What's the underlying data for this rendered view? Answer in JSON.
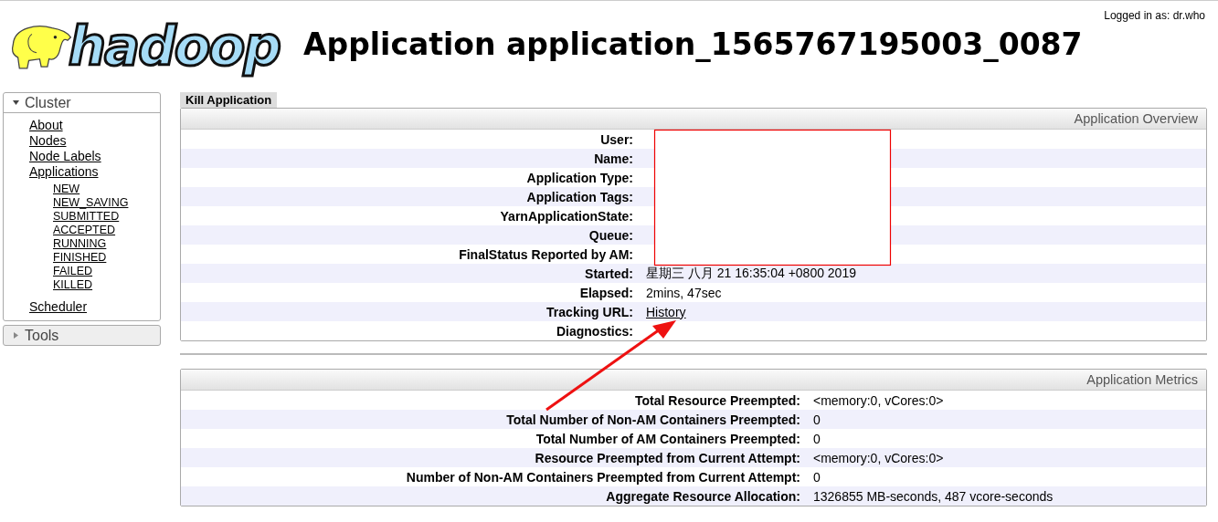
{
  "header": {
    "logo_text": "hadoop",
    "title": "Application application_1565767195003_0087",
    "login": "Logged in as: dr.who"
  },
  "sidebar": {
    "sections": [
      {
        "title": "Cluster",
        "expanded": true,
        "items": [
          {
            "label": "About"
          },
          {
            "label": "Nodes"
          },
          {
            "label": "Node Labels"
          },
          {
            "label": "Applications",
            "children": [
              {
                "label": "NEW"
              },
              {
                "label": "NEW_SAVING"
              },
              {
                "label": "SUBMITTED"
              },
              {
                "label": "ACCEPTED"
              },
              {
                "label": "RUNNING"
              },
              {
                "label": "FINISHED"
              },
              {
                "label": "FAILED"
              },
              {
                "label": "KILLED"
              }
            ]
          },
          {
            "label": "Scheduler"
          }
        ]
      },
      {
        "title": "Tools",
        "expanded": false
      }
    ]
  },
  "actions": [
    "Kill Application"
  ],
  "overview": {
    "title": "Application Overview",
    "rows": [
      {
        "label": "User:"
      },
      {
        "label": "Name:"
      },
      {
        "label": "Application Type:"
      },
      {
        "label": "Application Tags:"
      },
      {
        "label": "YarnApplicationState:"
      },
      {
        "label": "Queue:"
      },
      {
        "label": "FinalStatus Reported by AM:"
      },
      {
        "label": "Started:",
        "value": "星期三 八月 21 16:35:04 +0800 2019",
        "kind": "text"
      },
      {
        "label": "Elapsed:",
        "value": "2mins, 47sec",
        "kind": "text"
      },
      {
        "label": "Tracking URL:",
        "value": "History",
        "kind": "link"
      },
      {
        "label": "Diagnostics:"
      }
    ]
  },
  "metrics": {
    "title": "Application Metrics",
    "rows": [
      {
        "label": "Total Resource Preempted:",
        "value": "<memory:0, vCores:0>"
      },
      {
        "label": "Total Number of Non-AM Containers Preempted:",
        "value": "0"
      },
      {
        "label": "Total Number of AM Containers Preempted:",
        "value": "0"
      },
      {
        "label": "Resource Preempted from Current Attempt:",
        "value": "<memory:0, vCores:0>"
      },
      {
        "label": "Number of Non-AM Containers Preempted from Current Attempt:",
        "value": "0"
      },
      {
        "label": "Aggregate Resource Allocation:",
        "value": "1326855 MB-seconds, 487 vcore-seconds"
      }
    ]
  }
}
